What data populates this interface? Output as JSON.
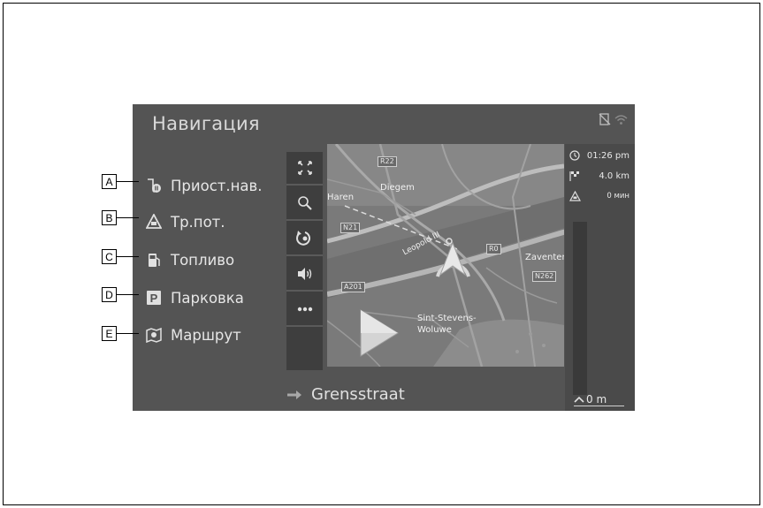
{
  "screen": {
    "title": "Навигация",
    "status_icons": [
      "phone-disabled-icon",
      "wifi-icon"
    ]
  },
  "menu": {
    "items": [
      {
        "callout": "A",
        "label": "Приост.нав.",
        "icon": "pause-guidance-icon"
      },
      {
        "callout": "B",
        "label": "Тр.пот.",
        "icon": "traffic-warning-icon"
      },
      {
        "callout": "C",
        "label": "Топливо",
        "icon": "fuel-icon"
      },
      {
        "callout": "D",
        "label": "Парковка",
        "icon": "parking-icon"
      },
      {
        "callout": "E",
        "label": "Маршрут",
        "icon": "route-icon"
      }
    ]
  },
  "toolbar": {
    "buttons": [
      "fullscreen-icon",
      "search-icon",
      "reroute-icon",
      "volume-icon",
      "more-icon"
    ]
  },
  "map": {
    "road_labels": [
      "R22",
      "N21",
      "A201",
      "R0",
      "N262"
    ],
    "places": [
      "Haren",
      "Diegem",
      "Zaventem",
      "Leopold III",
      "Sint-Stevens-",
      "Woluwe"
    ]
  },
  "info": {
    "arrival_time": "01:26 pm",
    "distance": "4.0 km",
    "traffic_delay": "0 мин",
    "bottom_distance": "0 m"
  },
  "street": {
    "name": "Grensstraat"
  }
}
